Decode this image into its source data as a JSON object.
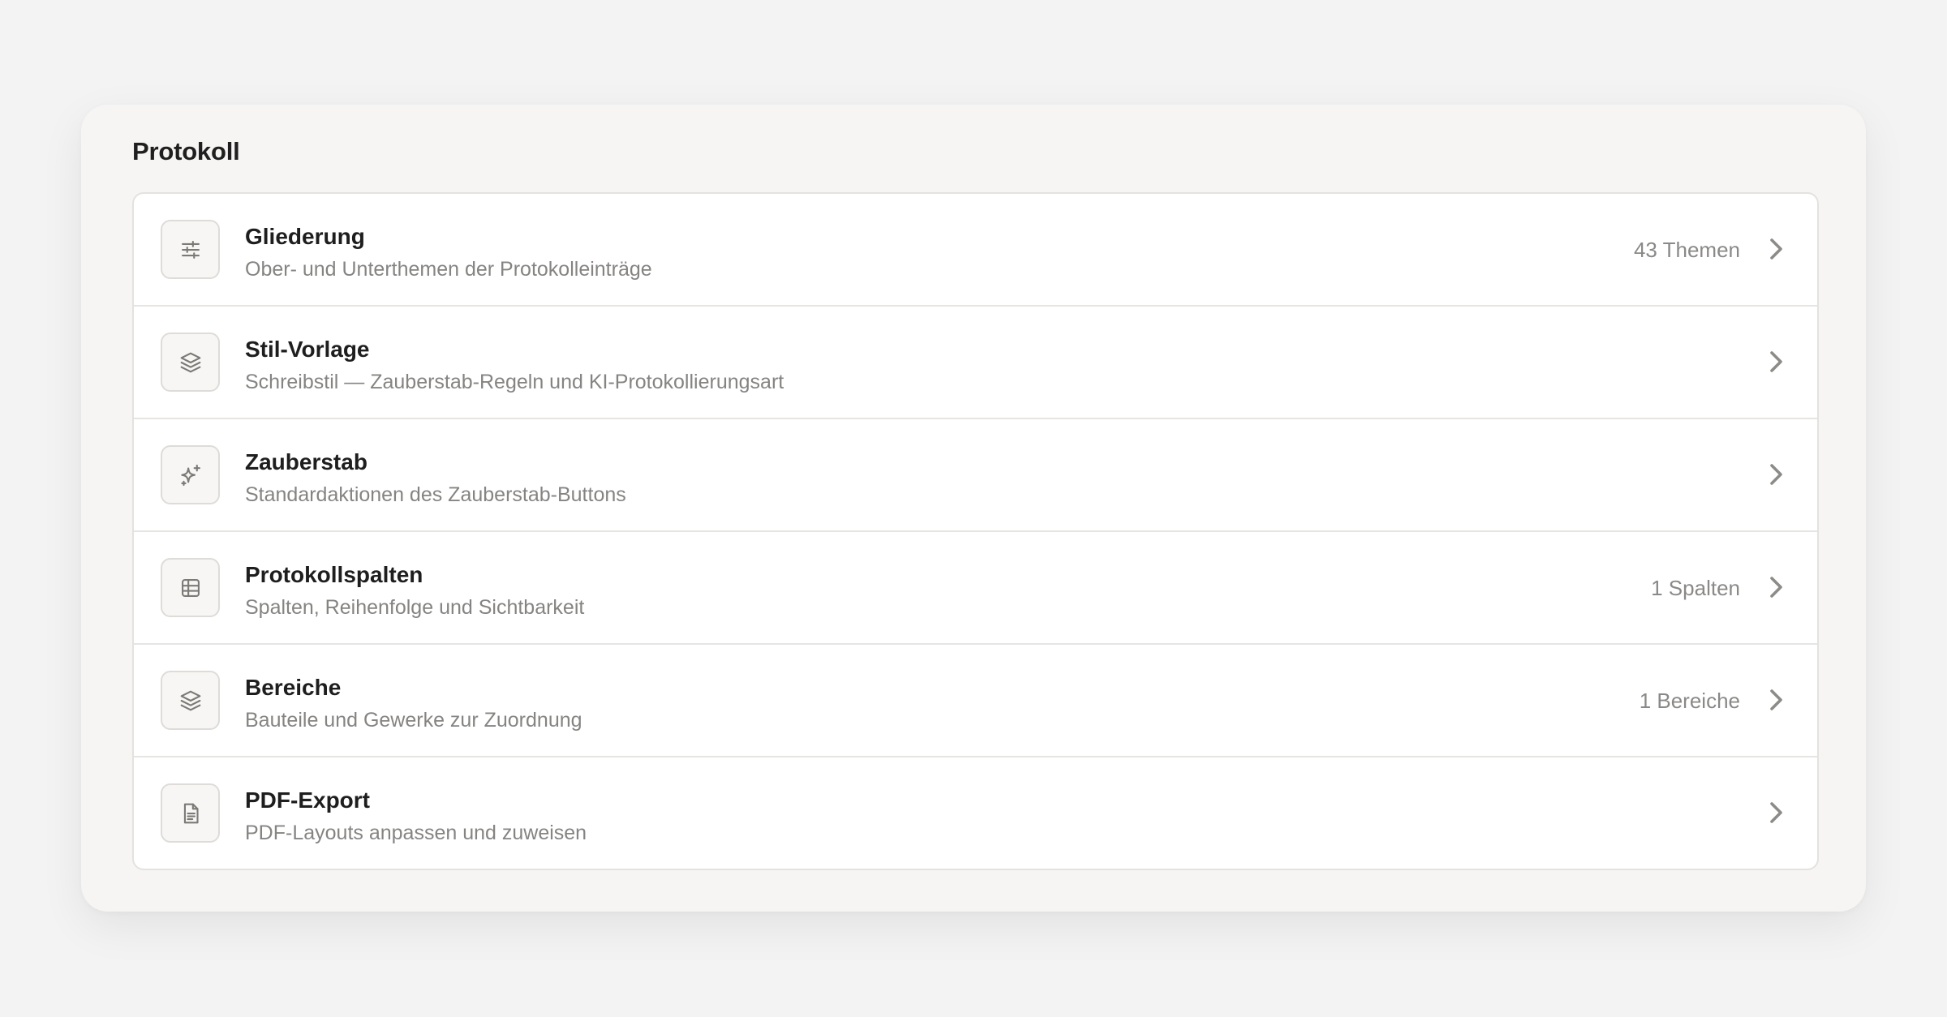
{
  "section": {
    "title": "Protokoll"
  },
  "items": [
    {
      "title": "Gliederung",
      "subtitle": "Ober- und Unterthemen der Protokolleinträge",
      "meta": "43 Themen",
      "icon": "sliders-icon"
    },
    {
      "title": "Stil-Vorlage",
      "subtitle": "Schreibstil — Zauberstab-Regeln und KI-Protokollierungsart",
      "meta": "",
      "icon": "layers-icon"
    },
    {
      "title": "Zauberstab",
      "subtitle": "Standardaktionen des Zauberstab-Buttons",
      "meta": "",
      "icon": "sparkles-icon"
    },
    {
      "title": "Protokollspalten",
      "subtitle": "Spalten, Reihenfolge und Sichtbarkeit",
      "meta": "1 Spalten",
      "icon": "table-icon"
    },
    {
      "title": "Bereiche",
      "subtitle": "Bauteile und Gewerke zur Zuordnung",
      "meta": "1 Bereiche",
      "icon": "layers-icon"
    },
    {
      "title": "PDF-Export",
      "subtitle": "PDF-Layouts anpassen und zuweisen",
      "meta": "",
      "icon": "document-icon"
    }
  ],
  "colors": {
    "background": "#f3f3f3",
    "card": "#f6f5f3",
    "list": "#ffffff",
    "title_text": "#1e1e1e",
    "secondary_text": "#858482",
    "icon_stroke": "#7b7a77"
  }
}
